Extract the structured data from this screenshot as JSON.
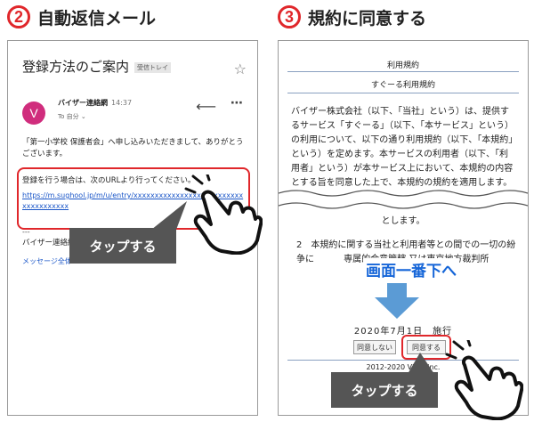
{
  "steps": [
    {
      "number": "2",
      "title": "自動返信メール"
    },
    {
      "number": "3",
      "title": "規約に同意する"
    }
  ],
  "mail": {
    "subject": "登録方法のご案内",
    "inbox_badge": "受信トレイ",
    "avatar_letter": "V",
    "sender": "バイザー連絡網",
    "time": "14:37",
    "to": "To 自分 ⌄",
    "intro": "「第一小学校 保護者会」へ申し込みいただきまして、ありがとうございます。",
    "register_text": "登録を行う場合は、次のURLより行ってください。",
    "url": "https://m.sughool.jp/m/u/entry/xxxxxxxxxxxxxxxxxxxxxxxxxxxxxxxxxxxxx",
    "separator": "---",
    "signature": "バイザー連絡網",
    "message_all": "メッセージ全体"
  },
  "terms": {
    "title": "利用規約",
    "subtitle": "すぐーる利用規約",
    "body": "バイザー株式会社（以下、「当社」という）は、提供するサービス「すぐーる」（以下、「本サービス」という）の利用について、以下の通り利用規約（以下、「本規約」という）を定めます。本サービスの利用者（以下、「利用者」という）が本サービス上において、本規約の内容とする旨を同意した上で、本規約の規約を適用します。",
    "toshimasu": "とします。",
    "article2": "2　本規約に関する当社と利用者等との間での一切の紛争に 　　　専属的合意管轄 又は東京地方裁判所 　　　　　　　　　とします。",
    "scroll_hint": "画面一番下へ",
    "date": "2020年7月1日　施行",
    "disagree": "同意しない",
    "agree": "同意する",
    "copyright": "2012-2020 Visor Inc."
  },
  "tap_label": "タップする",
  "colors": {
    "accent_red": "#e0272b",
    "link_blue": "#1a56c8",
    "hint_blue": "#1565d8",
    "avatar": "#d02d7d",
    "label_gray": "#555555"
  }
}
